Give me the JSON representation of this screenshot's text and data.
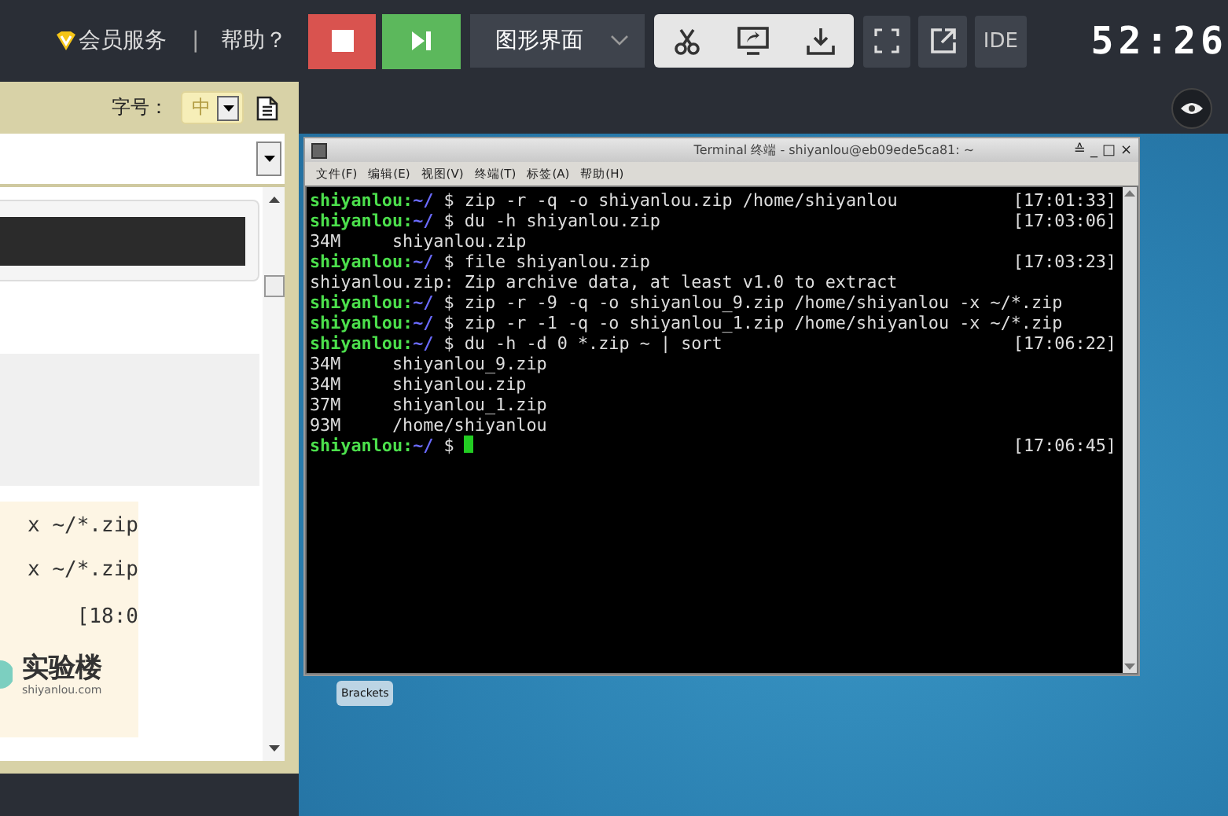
{
  "topbar": {
    "member": "会员服务",
    "separator": "|",
    "help": "帮助？",
    "mode": "图形界面",
    "ide": "IDE",
    "timer": "52:26"
  },
  "doc_panel": {
    "font_label": "字号：",
    "font_size": "中",
    "snippet_lines": [
      "x ~/*.zip",
      "x ~/*.zip",
      "[18:0"
    ],
    "logo_text": "实验楼",
    "logo_domain": "shiyanlou.com"
  },
  "terminal": {
    "title": "Terminal 终端 - shiyanlou@eb09ede5ca81: ~",
    "window_controls": [
      "≙",
      "_",
      "□",
      "×"
    ],
    "menu": [
      "文件(F)",
      "编辑(E)",
      "视图(V)",
      "终端(T)",
      "标签(A)",
      "帮助(H)"
    ],
    "lines": [
      {
        "kind": "prompt",
        "user": "shiyanlou:",
        "path": "~/",
        "sign": "$",
        "command": "zip -r -q -o shiyanlou.zip /home/shiyanlou",
        "time": "[17:01:33]"
      },
      {
        "kind": "prompt",
        "user": "shiyanlou:",
        "path": "~/",
        "sign": "$",
        "command": "du -h shiyanlou.zip",
        "time": "[17:03:06]"
      },
      {
        "kind": "output",
        "text": "34M     shiyanlou.zip"
      },
      {
        "kind": "prompt",
        "user": "shiyanlou:",
        "path": "~/",
        "sign": "$",
        "command": "file shiyanlou.zip",
        "time": "[17:03:23]"
      },
      {
        "kind": "output",
        "text": "shiyanlou.zip: Zip archive data, at least v1.0 to extract"
      },
      {
        "kind": "prompt",
        "user": "shiyanlou:",
        "path": "~/",
        "sign": "$",
        "command": "zip -r -9 -q -o shiyanlou_9.zip /home/shiyanlou -x ~/*.zip"
      },
      {
        "kind": "prompt",
        "user": "shiyanlou:",
        "path": "~/",
        "sign": "$",
        "command": "zip -r -1 -q -o shiyanlou_1.zip /home/shiyanlou -x ~/*.zip"
      },
      {
        "kind": "prompt",
        "user": "shiyanlou:",
        "path": "~/",
        "sign": "$",
        "command": "du -h -d 0 *.zip ~ | sort",
        "time": "[17:06:22]"
      },
      {
        "kind": "output",
        "text": "34M     shiyanlou_9.zip"
      },
      {
        "kind": "output",
        "text": "34M     shiyanlou.zip"
      },
      {
        "kind": "output",
        "text": "37M     shiyanlou_1.zip"
      },
      {
        "kind": "output",
        "text": "93M     /home/shiyanlou"
      },
      {
        "kind": "prompt",
        "user": "shiyanlou:",
        "path": "~/",
        "sign": "$",
        "time": "[17:06:45]",
        "cursor": true
      }
    ]
  },
  "desktop": {
    "icons": [
      {
        "label": "Brackets"
      }
    ]
  }
}
